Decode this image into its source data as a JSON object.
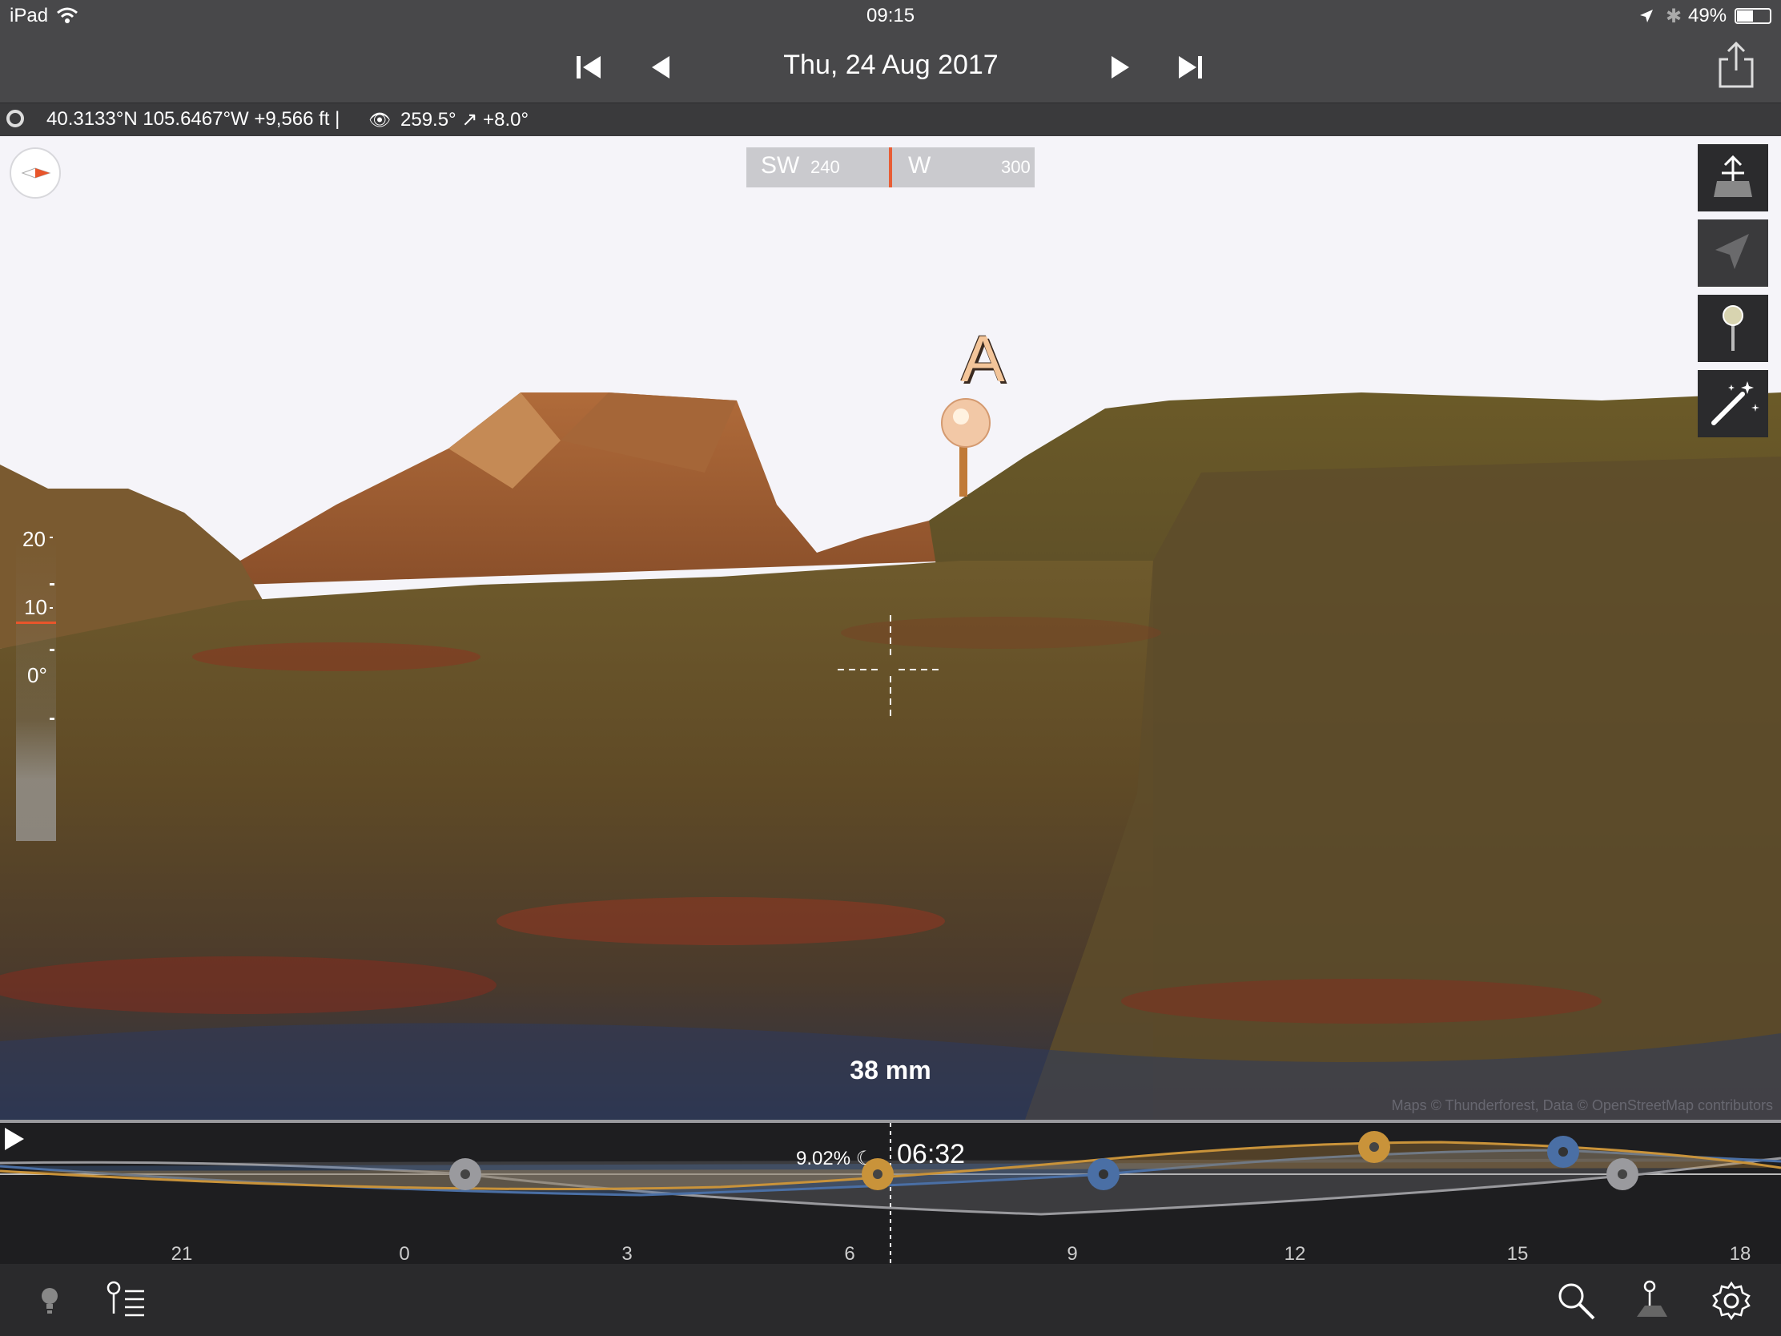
{
  "status": {
    "device": "iPad",
    "time": "09:15",
    "battery": "49%"
  },
  "nav": {
    "date": "Thu, 24 Aug 2017",
    "buttons": [
      "skip-back-icon",
      "step-back-icon",
      "step-forward-icon",
      "skip-forward-icon",
      "share-icon"
    ]
  },
  "info": {
    "location": "40.3133°N 105.6467°W +9,566 ft |",
    "view": "259.5° ↗ +8.0°"
  },
  "compass": {
    "left_label": "SW",
    "left_deg": "240",
    "center_label": "W",
    "right_deg": "300"
  },
  "scene": {
    "marker": "A",
    "focal_length": "38 mm",
    "attribution": "Maps © Thunderforest, Data © OpenStreetMap contributors",
    "scale_labels": [
      "20",
      "10",
      "0"
    ],
    "scale_units": "°"
  },
  "timeline": {
    "moon_pct": "9.02%",
    "time": "06:32",
    "hours": [
      "21",
      "0",
      "3",
      "6",
      "9",
      "12",
      "15",
      "18"
    ]
  },
  "colors": {
    "accent": "#e8552b",
    "sun": "#c9933a",
    "moon": "#4a6fa5",
    "milkyway": "#9a9a9e"
  }
}
